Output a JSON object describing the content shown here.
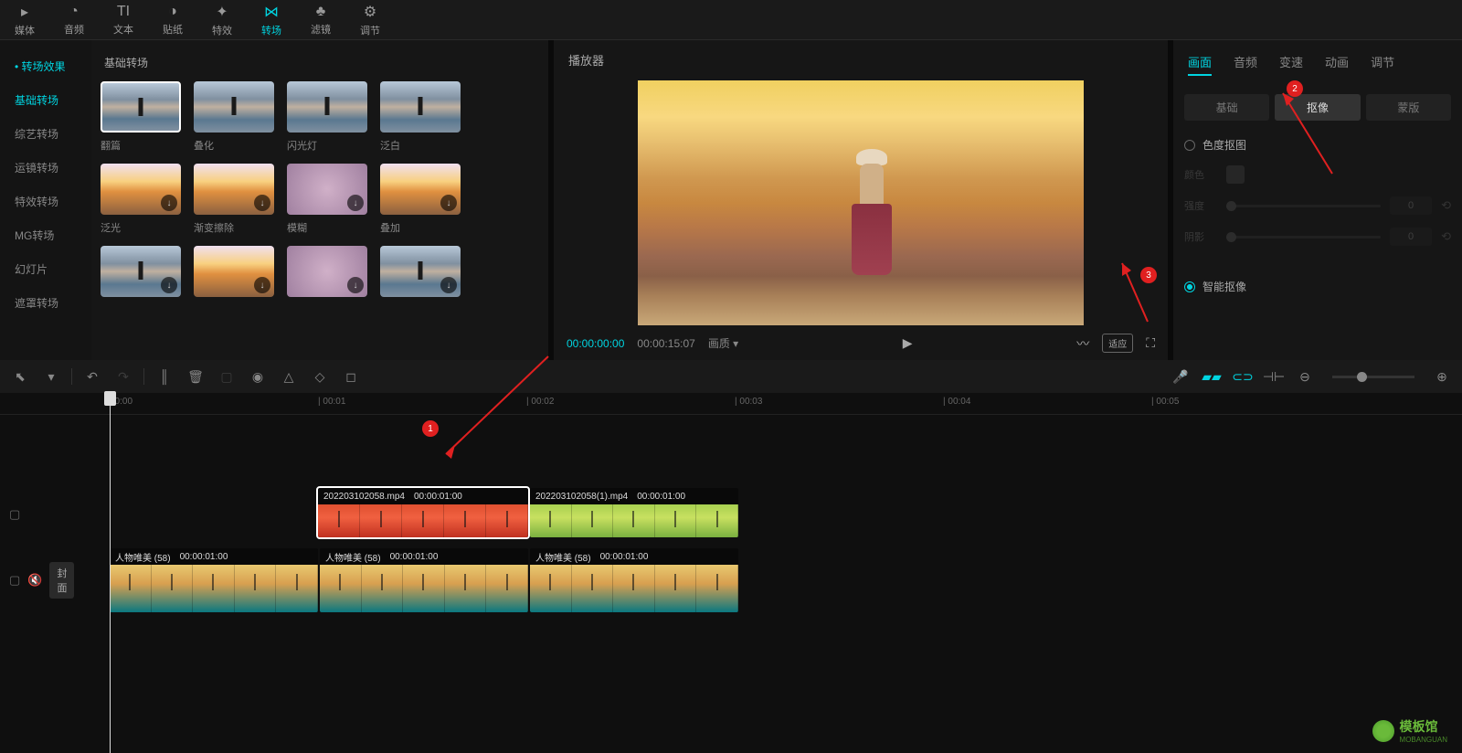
{
  "top_tools": [
    {
      "icon": "▸",
      "label": "媒体"
    },
    {
      "icon": "◔",
      "label": "音频"
    },
    {
      "icon": "TI",
      "label": "文本"
    },
    {
      "icon": "◑",
      "label": "贴纸"
    },
    {
      "icon": "✦",
      "label": "特效"
    },
    {
      "icon": "⋈",
      "label": "转场",
      "active": true
    },
    {
      "icon": "♣",
      "label": "滤镜"
    },
    {
      "icon": "⚙",
      "label": "调节"
    }
  ],
  "left_sidebar": {
    "title": "• 转场效果",
    "items": [
      {
        "label": "基础转场",
        "active": true
      },
      {
        "label": "综艺转场"
      },
      {
        "label": "运镜转场"
      },
      {
        "label": "特效转场"
      },
      {
        "label": "MG转场"
      },
      {
        "label": "幻灯片"
      },
      {
        "label": "遮罩转场"
      }
    ]
  },
  "transitions": {
    "title": "基础转场",
    "row1": [
      {
        "label": "翻篇",
        "thumb": "beach",
        "selected": true
      },
      {
        "label": "叠化",
        "thumb": "beach"
      },
      {
        "label": "闪光灯",
        "thumb": "beach"
      },
      {
        "label": "泛白",
        "thumb": "beach"
      }
    ],
    "row2": [
      {
        "label": "泛光",
        "thumb": "sunset",
        "dl": true
      },
      {
        "label": "渐变擦除",
        "thumb": "sunset",
        "dl": true
      },
      {
        "label": "模糊",
        "thumb": "blur",
        "dl": true
      },
      {
        "label": "叠加",
        "thumb": "sunset",
        "dl": true
      }
    ],
    "row3": [
      {
        "label": "",
        "thumb": "beach",
        "dl": true
      },
      {
        "label": "",
        "thumb": "sunset",
        "dl": true
      },
      {
        "label": "",
        "thumb": "blur",
        "dl": true
      },
      {
        "label": "",
        "thumb": "beach",
        "dl": true
      }
    ]
  },
  "player": {
    "title": "播放器",
    "time_current": "00:00:00:00",
    "time_total": "00:00:15:07",
    "quality": "画质 ▾",
    "fit": "适应"
  },
  "right_panel": {
    "tabs": [
      {
        "label": "画面",
        "active": true
      },
      {
        "label": "音频"
      },
      {
        "label": "变速"
      },
      {
        "label": "动画"
      },
      {
        "label": "调节"
      }
    ],
    "sub_tabs": [
      {
        "label": "基础"
      },
      {
        "label": "抠像",
        "active": true
      },
      {
        "label": "蒙版"
      }
    ],
    "chroma": {
      "label": "色度抠图",
      "color_label": "颜色",
      "intensity_label": "强度",
      "intensity_val": "0",
      "shadow_label": "阴影",
      "shadow_val": "0"
    },
    "smart": {
      "label": "智能抠像",
      "checked": true
    }
  },
  "timeline_toolbar": {
    "left": [
      "↖",
      "▾",
      "↶",
      "↷",
      "⟊",
      "🗑",
      "▢",
      "◉",
      "△",
      "◇",
      "▭"
    ],
    "right_mic": "🎤"
  },
  "ruler_marks": [
    {
      "label": "00:00",
      "pos": 120
    },
    {
      "label": "| 00:01",
      "pos": 348
    },
    {
      "label": "| 00:02",
      "pos": 576
    },
    {
      "label": "| 00:03",
      "pos": 804
    },
    {
      "label": "| 00:04",
      "pos": 1032
    },
    {
      "label": "| 00:05",
      "pos": 1260
    }
  ],
  "clips": {
    "clip1": {
      "name": "202203102058.mp4",
      "time": "00:00:01:00"
    },
    "clip2": {
      "name": "202203102058(1).mp4",
      "time": "00:00:01:00"
    },
    "clip3a": {
      "name": "人物唯美 (58)",
      "time": "00:00:01:00"
    },
    "clip3b": {
      "name": "人物唯美 (58)",
      "time": "00:00:01:00"
    },
    "clip3c": {
      "name": "人物唯美 (58)",
      "time": "00:00:01:00"
    }
  },
  "track_cover": "封面",
  "annotations": {
    "badge1": "1",
    "badge2": "2",
    "badge3": "3"
  },
  "watermark": {
    "text": "模板馆",
    "sub": "MOBANGUAN"
  }
}
